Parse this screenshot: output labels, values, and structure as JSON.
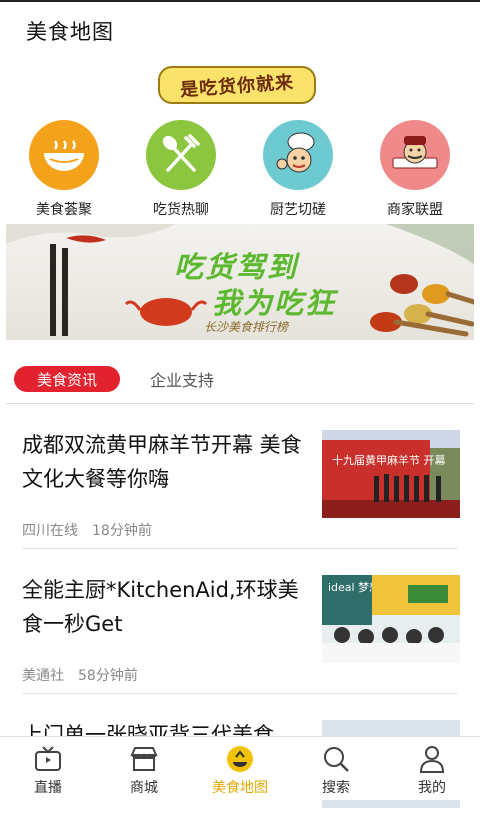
{
  "header": {
    "title": "美食地图"
  },
  "slogan": {
    "text": "是吃货你就来"
  },
  "categories": [
    {
      "label": "美食荟聚",
      "icon": "soup-bowl-icon",
      "color": "#f5a21b"
    },
    {
      "label": "吃货热聊",
      "icon": "fork-spoon-icon",
      "color": "#8cc63e"
    },
    {
      "label": "厨艺切磋",
      "icon": "chef-icon",
      "color": "#6dcad0"
    },
    {
      "label": "商家联盟",
      "icon": "merchant-icon",
      "color": "#f08a8a"
    }
  ],
  "banner": {
    "line1": "吃货驾到",
    "line2": "我为吃狂",
    "line3": "长沙美食排行榜"
  },
  "tabs": {
    "active": "美食资讯",
    "inactive": "企业支持"
  },
  "articles": [
    {
      "headline": "成都双流黄甲麻羊节开幕 美食文化大餐等你嗨",
      "source": "四川在线",
      "time": "18分钟前",
      "thumb_text": "十九届黄甲麻羊节 开幕"
    },
    {
      "headline": "全能主厨*KitchenAid,环球美食一秒Get",
      "source": "美通社",
      "time": "58分钟前",
      "thumb_text": "ideal 梦想家"
    },
    {
      "headline": "上门单一张晓亚背三代美食",
      "source": "",
      "time": ""
    }
  ],
  "tabbar": [
    {
      "label": "直播",
      "icon": "tv-icon",
      "active": false
    },
    {
      "label": "商城",
      "icon": "shop-icon",
      "active": false
    },
    {
      "label": "美食地图",
      "icon": "food-map-icon",
      "active": true
    },
    {
      "label": "搜索",
      "icon": "search-icon",
      "active": false
    },
    {
      "label": "我的",
      "icon": "user-icon",
      "active": false
    }
  ],
  "colors": {
    "accent_red": "#e2222f",
    "active_tab_yellow": "#e2a800"
  }
}
